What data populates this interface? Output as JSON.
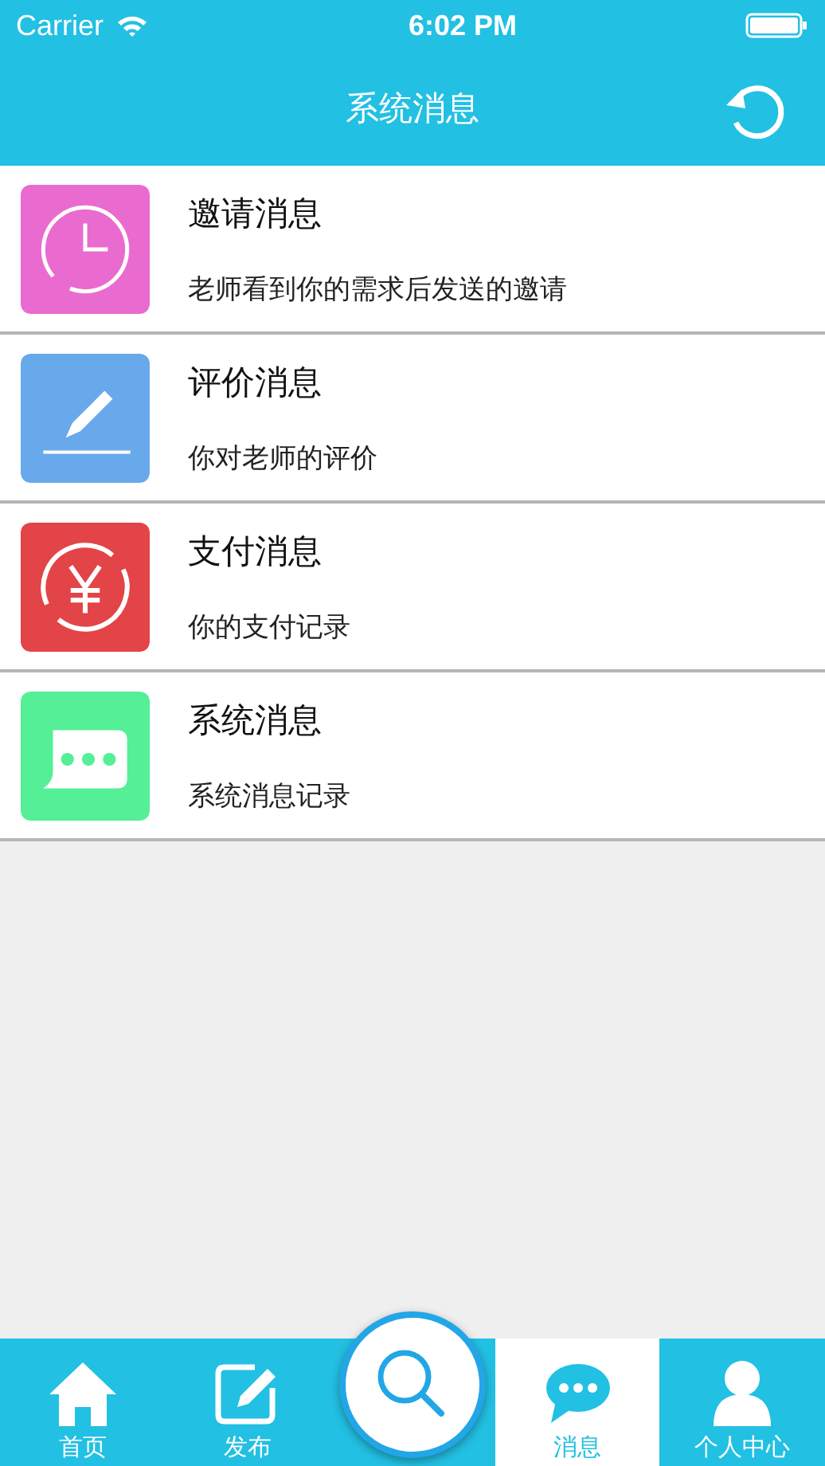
{
  "status_bar": {
    "carrier": "Carrier",
    "time": "6:02 PM"
  },
  "nav": {
    "title": "系统消息"
  },
  "messages": [
    {
      "kind": "clock",
      "color": "#ea6bd0",
      "title": "邀请消息",
      "subtitle": "老师看到你的需求后发送的邀请"
    },
    {
      "kind": "pencil",
      "color": "#68a9ec",
      "title": "评价消息",
      "subtitle": "你对老师的评价"
    },
    {
      "kind": "yen",
      "color": "#e34448",
      "title": "支付消息",
      "subtitle": "你的支付记录"
    },
    {
      "kind": "chat",
      "color": "#55ef98",
      "title": "系统消息",
      "subtitle": "系统消息记录"
    }
  ],
  "tabs": [
    {
      "kind": "home",
      "label": "首页",
      "selected": false
    },
    {
      "kind": "compose",
      "label": "发布",
      "selected": false
    },
    {
      "kind": "search",
      "selected": false
    },
    {
      "kind": "chat",
      "label": "消息",
      "selected": true
    },
    {
      "kind": "person",
      "label": "个人中心",
      "selected": false
    }
  ]
}
